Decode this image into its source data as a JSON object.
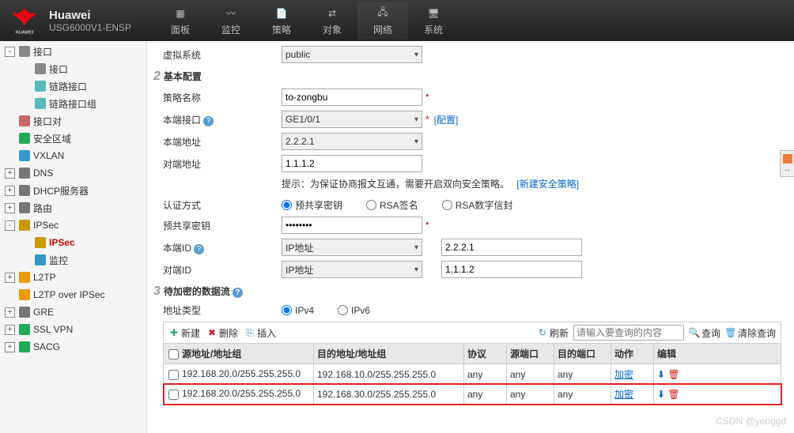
{
  "brand": {
    "title": "Huawei",
    "subtitle": "USG6000V1-ENSP",
    "logo_label": "HUAWEI"
  },
  "toptabs": [
    {
      "id": "dashboard",
      "label": "面板"
    },
    {
      "id": "monitor",
      "label": "监控"
    },
    {
      "id": "policy",
      "label": "策略"
    },
    {
      "id": "object",
      "label": "对象"
    },
    {
      "id": "network",
      "label": "网络",
      "active": true
    },
    {
      "id": "system",
      "label": "系统"
    }
  ],
  "sidebar": [
    {
      "lvl": 1,
      "toggle": "-",
      "icon": "interface-icon",
      "label": "接口"
    },
    {
      "lvl": 2,
      "icon": "interface-icon",
      "label": "接口"
    },
    {
      "lvl": 2,
      "icon": "linkif-icon",
      "label": "链路接口"
    },
    {
      "lvl": 2,
      "icon": "linkgrp-icon",
      "label": "链路接口组"
    },
    {
      "lvl": 1,
      "icon": "ifpair-icon",
      "label": "接口对"
    },
    {
      "lvl": 1,
      "icon": "shield-icon",
      "label": "安全区域"
    },
    {
      "lvl": 1,
      "icon": "vxlan-icon",
      "label": "VXLAN"
    },
    {
      "lvl": 1,
      "toggle": "+",
      "icon": "dns-icon",
      "label": "DNS"
    },
    {
      "lvl": 1,
      "toggle": "+",
      "icon": "dhcp-icon",
      "label": "DHCP服务器"
    },
    {
      "lvl": 1,
      "toggle": "+",
      "icon": "route-icon",
      "label": "路由"
    },
    {
      "lvl": 1,
      "toggle": "-",
      "icon": "ipsec-icon",
      "label": "IPSec"
    },
    {
      "lvl": 2,
      "icon": "ipsec-icon",
      "label": "IPSec",
      "hl": true
    },
    {
      "lvl": 2,
      "icon": "monitor-icon",
      "label": "监控"
    },
    {
      "lvl": 1,
      "toggle": "+",
      "icon": "l2tp-icon",
      "label": "L2TP"
    },
    {
      "lvl": 1,
      "icon": "l2tpipsec-icon",
      "label": "L2TP over IPSec"
    },
    {
      "lvl": 1,
      "toggle": "+",
      "icon": "gre-icon",
      "label": "GRE"
    },
    {
      "lvl": 1,
      "toggle": "+",
      "icon": "sslvpn-icon",
      "label": "SSL VPN"
    },
    {
      "lvl": 1,
      "toggle": "+",
      "icon": "sacg-icon",
      "label": "SACG"
    }
  ],
  "form": {
    "vsys_label": "虚拟系统",
    "vsys_value": "public",
    "section2": "基本配置",
    "name_label": "策略名称",
    "name_value": "to-zongbu",
    "localif_label": "本端接口",
    "localif_value": "GE1/0/1",
    "localif_configure": "[配置]",
    "localaddr_label": "本端地址",
    "localaddr_value": "2.2.2.1",
    "peeraddr_label": "对端地址",
    "peeraddr_value": "1.1.1.2",
    "hint": "提示：为保证协商报文互通，需要开启双向安全策略。",
    "hint_link": "[新建安全策略]",
    "auth_label": "认证方式",
    "auth_opts": [
      "预共享密钥",
      "RSA签名",
      "RSA数字信封"
    ],
    "psk_label": "预共享密钥",
    "psk_value": "••••••••",
    "localid_label": "本端ID",
    "localid_kind": "IP地址",
    "localid_value": "2.2.2.1",
    "peerid_label": "对端ID",
    "peerid_kind": "IP地址",
    "peerid_value": "1.1.1.2",
    "section3": "待加密的数据流",
    "addrtype_label": "地址类型",
    "addrtype_opts": [
      "IPv4",
      "IPv6"
    ]
  },
  "toolbar": {
    "new": "新建",
    "del": "删除",
    "insert": "插入",
    "refresh": "刷新",
    "search_ph": "请输入要查询的内容",
    "query": "查询",
    "clear": "清除查询"
  },
  "grid": {
    "cols": [
      "源地址/地址组",
      "目的地址/地址组",
      "协议",
      "源端口",
      "目的端口",
      "动作",
      "编辑"
    ],
    "rows": [
      {
        "src": "192.168.20.0/255.255.255.0",
        "dst": "192.168.10.0/255.255.255.0",
        "proto": "any",
        "sport": "any",
        "dport": "any",
        "action": "加密"
      },
      {
        "src": "192.168.20.0/255.255.255.0",
        "dst": "192.168.30.0/255.255.255.0",
        "proto": "any",
        "sport": "any",
        "dport": "any",
        "action": "加密",
        "hl": true
      }
    ]
  },
  "watermark": "CSDN @yenggd"
}
